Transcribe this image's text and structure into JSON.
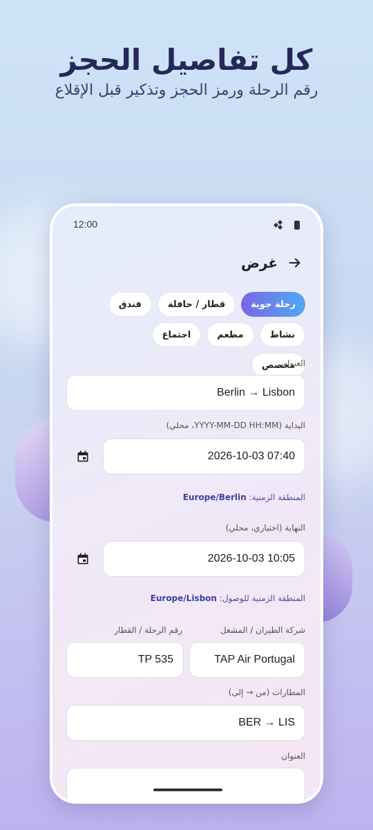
{
  "promo": {
    "title": "كل تفاصيل الحجز",
    "subtitle": "رقم الرحلة ورمز الحجز وتذكير قبل الإقلاع"
  },
  "status_bar": {
    "time": "12:00"
  },
  "screen": {
    "title": "غرض"
  },
  "chips": [
    {
      "label": "رحلة جوية",
      "active": true
    },
    {
      "label": "قطار / حافلة",
      "active": false
    },
    {
      "label": "فندق",
      "active": false
    },
    {
      "label": "نشاط",
      "active": false
    },
    {
      "label": "مطعم",
      "active": false
    },
    {
      "label": "اجتماع",
      "active": false
    },
    {
      "label": "مخصص",
      "active": false
    }
  ],
  "form": {
    "title_label": "العنوان",
    "title_value": "Berlin → Lisbon",
    "start_label": "البداية (YYYY-MM-DD HH:MM، محلي)",
    "start_value": "2026-10-03 07:40",
    "start_tz_label": "المنطقة الزمنية:",
    "start_tz_value": "Europe/Berlin",
    "end_label": "النهاية (اختياري، محلي)",
    "end_value": "2026-10-03 10:05",
    "end_tz_label": "المنطقة الزمنية للوصول:",
    "end_tz_value": "Europe/Lisbon",
    "airline_label": "شركة الطيران / المشغل",
    "airline_value": "TAP Air Portugal",
    "flight_no_label": "رقم الرحلة / القطار",
    "flight_no_value": "TP 535",
    "airports_label": "المطارات (من → إلى)",
    "airports_value": "BER → LIS",
    "address_label": "العنوان",
    "address_value": ""
  },
  "icons": {
    "back": "arrow-right-icon",
    "calendar": "calendar-icon",
    "signal": "signal-icon",
    "battery": "battery-icon"
  }
}
